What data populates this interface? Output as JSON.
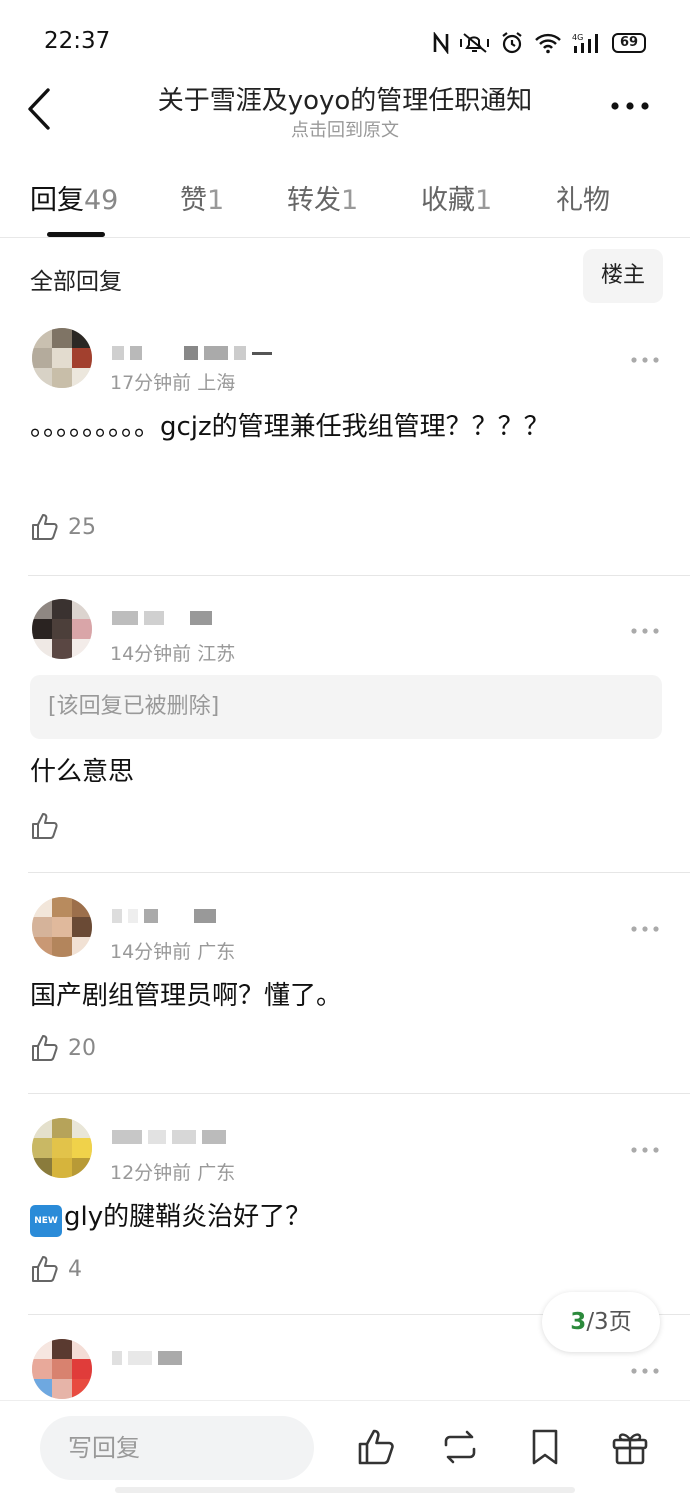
{
  "status_bar": {
    "time": "22:37",
    "battery": "69"
  },
  "header": {
    "title": "关于雪涯及yoyo的管理任职通知",
    "subtitle": "点击回到原文"
  },
  "tabs": [
    {
      "label": "回复",
      "count": "49"
    },
    {
      "label": "赞",
      "count": "1"
    },
    {
      "label": "转发",
      "count": "1"
    },
    {
      "label": "收藏",
      "count": "1"
    },
    {
      "label": "礼物",
      "count": ""
    }
  ],
  "section": {
    "title": "全部回复",
    "filter": "楼主"
  },
  "comments": [
    {
      "meta": "17分钟前 上海",
      "text": "。。。。。。。。。gcjz的管理兼任我组管理？？？？",
      "likes": "25"
    },
    {
      "meta": "14分钟前 江苏",
      "quoted": "[该回复已被删除]",
      "text": "什么意思",
      "likes": ""
    },
    {
      "meta": "14分钟前 广东",
      "text": "国产剧组管理员啊？懂了。",
      "likes": "20"
    },
    {
      "meta": "12分钟前 广东",
      "badge": "NEW",
      "text": "gly的腱鞘炎治好了？",
      "likes": "4"
    }
  ],
  "pagination": {
    "current": "3",
    "total_label": "/3页"
  },
  "bottom_bar": {
    "reply_placeholder": "写回复"
  },
  "colors": {
    "accent_green": "#2c8a3c",
    "badge_blue": "#2a8bd8"
  }
}
